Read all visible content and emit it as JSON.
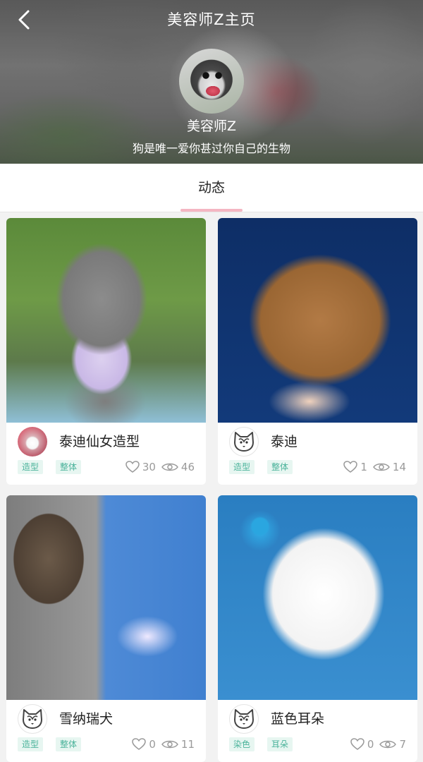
{
  "header": {
    "title": "美容师Z主页",
    "profile_name": "美容师Z",
    "profile_bio": "狗是唯一爱你甚过你自己的生物"
  },
  "tabs": [
    {
      "label": "动态",
      "active": true
    }
  ],
  "colors": {
    "tag_text": "#4bb39b",
    "tag_bg": "#e7f6f1",
    "tab_underline": "#f4b6c2"
  },
  "cards": [
    {
      "title": "泰迪仙女造型",
      "tags": [
        "造型",
        "整体"
      ],
      "likes": "30",
      "views": "46",
      "avatar_icon": "poodle-avatar"
    },
    {
      "title": "泰迪",
      "tags": [
        "造型",
        "整体"
      ],
      "likes": "1",
      "views": "14",
      "avatar_icon": "husky-avatar"
    },
    {
      "title": "雪纳瑞犬",
      "tags": [
        "造型",
        "整体"
      ],
      "likes": "0",
      "views": "11",
      "avatar_icon": "husky-avatar"
    },
    {
      "title": "蓝色耳朵",
      "tags": [
        "染色",
        "耳朵"
      ],
      "likes": "0",
      "views": "7",
      "avatar_icon": "husky-avatar"
    }
  ]
}
